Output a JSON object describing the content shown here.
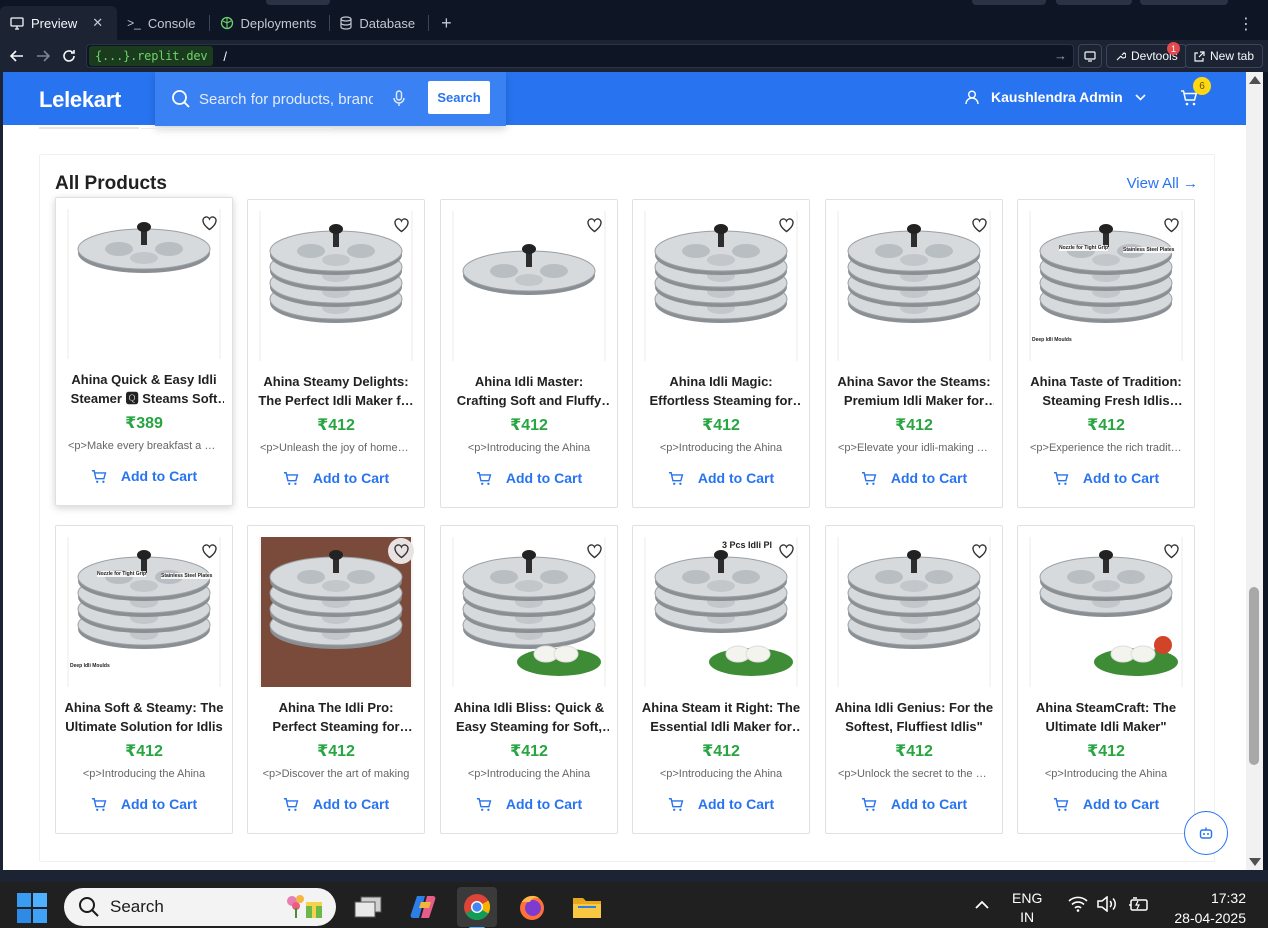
{
  "ide": {
    "tabs": [
      {
        "label": "Preview",
        "icon": "monitor-icon"
      },
      {
        "label": "Console",
        "icon": "terminal-icon"
      },
      {
        "label": "Deployments",
        "icon": "deploy-icon"
      },
      {
        "label": "Database",
        "icon": "database-icon"
      }
    ],
    "url_domain": "{...}.replit.dev",
    "url_path": "/",
    "devtools_label": "Devtools",
    "devtools_badge": "1",
    "newtab_label": "New tab"
  },
  "site": {
    "brand": "Lelekart",
    "search_placeholder": "Search for products, brands and more",
    "search_button": "Search",
    "user_name": "Kaushlendra Admin",
    "cart_count": "6",
    "accent_color": "#2874f0",
    "price_color": "#26a541"
  },
  "section": {
    "title": "All Products",
    "view_all": "View All →"
  },
  "products": [
    {
      "name": "Ahina Quick & Easy Idli Steamer 🆀 Steams Soft Fluffy Idlis",
      "price": "₹389",
      "desc": "<p>Make every breakfast a delight",
      "cart": "Add to Cart"
    },
    {
      "name": "Ahina Steamy Delights: The Perfect Idli Maker for You",
      "price": "₹412",
      "desc": "<p>Unleash the joy of homemade",
      "cart": "Add to Cart"
    },
    {
      "name": "Ahina Idli Master: Crafting Soft and Fluffy Idlis",
      "price": "₹412",
      "desc": "<p>Introducing the Ahina",
      "cart": "Add to Cart"
    },
    {
      "name": "Ahina Idli Magic: Effortless Steaming for Perfect Idlis",
      "price": "₹412",
      "desc": "<p>Introducing the Ahina",
      "cart": "Add to Cart"
    },
    {
      "name": "Ahina Savor the Steams: Premium Idli Maker for You",
      "price": "₹412",
      "desc": "<p>Elevate your idli-making game",
      "cart": "Add to Cart"
    },
    {
      "name": "Ahina Taste of Tradition: Steaming Fresh Idlis Daily",
      "price": "₹412",
      "desc": "<p>Experience the rich tradition",
      "cart": "Add to Cart"
    },
    {
      "name": "Ahina Soft & Steamy: The Ultimate Solution for Idlis",
      "price": "₹412",
      "desc": "<p>Introducing the Ahina",
      "cart": "Add to Cart"
    },
    {
      "name": "Ahina The Idli Pro: Perfect Steaming for Every Meal",
      "price": "₹412",
      "desc": "<p>Discover the art of making",
      "cart": "Add to Cart"
    },
    {
      "name": "Ahina Idli Bliss: Quick & Easy Steaming for Soft, Fluffy Idlis",
      "price": "₹412",
      "desc": "<p>Introducing the Ahina",
      "cart": "Add to Cart"
    },
    {
      "name": "Ahina Steam it Right: The Essential Idli Maker for You",
      "price": "₹412",
      "desc": "<p>Introducing the Ahina",
      "cart": "Add to Cart"
    },
    {
      "name": "Ahina Idli Genius: For the Softest, Fluffiest Idlis\"",
      "price": "₹412",
      "desc": "<p>Unlock the secret to the perfect",
      "cart": "Add to Cart"
    },
    {
      "name": "Ahina SteamCraft: The Ultimate Idli Maker\"",
      "price": "₹412",
      "desc": "<p>Introducing the Ahina",
      "cart": "Add to Cart"
    }
  ],
  "image_text": {
    "card6_label1": "Nozzle for Tight Grip",
    "card6_label2": "Stainless Steel Plates",
    "card6_label3": "Deep Idli Moulds",
    "card10_label": "3 Pcs Idli Pl"
  },
  "taskbar": {
    "search_label": "Search",
    "lang_line1": "ENG",
    "lang_line2": "IN",
    "time": "17:32",
    "date": "28-04-2025"
  }
}
